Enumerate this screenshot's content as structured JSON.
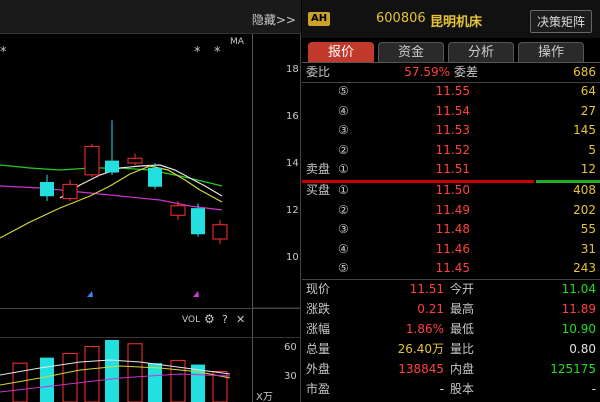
{
  "left_panel": {
    "hide_label": "隐藏>>",
    "ma_label": "MA",
    "stars": [
      "*",
      "*",
      "*"
    ],
    "y_ticks": [
      "18",
      "16",
      "14",
      "12",
      "10"
    ],
    "vol_label": "VOL",
    "vol_ticks": [
      "60",
      "30"
    ],
    "vol_unit": "X万"
  },
  "chart_data": {
    "type": "candlestick",
    "ylim": [
      9,
      19
    ],
    "y_ticks": [
      18,
      16,
      14,
      12,
      10
    ],
    "candles": [
      {
        "o": 13.0,
        "c": 14.1,
        "h": 15.9,
        "l": 12.9,
        "dir": "up"
      },
      {
        "o": 12.4,
        "c": 13.6,
        "h": 13.8,
        "l": 12.4,
        "dir": "up"
      },
      {
        "o": 13.7,
        "c": 13.4,
        "h": 14.2,
        "l": 13.3,
        "dir": "down"
      },
      {
        "o": 13.0,
        "c": 12.4,
        "h": 13.3,
        "l": 12.2,
        "dir": "down"
      },
      {
        "o": 12.0,
        "c": 11.4,
        "h": 12.3,
        "l": 11.2,
        "dir": "down"
      },
      {
        "o": 12.5,
        "c": 11.6,
        "h": 12.6,
        "l": 11.4,
        "dir": "down"
      }
    ],
    "volume_ylim": [
      0,
      75
    ],
    "volume_ticks": [
      60,
      30
    ]
  },
  "header": {
    "badge": "AH",
    "code": "600806",
    "name": "昆明机床",
    "decision_button": "决策矩阵"
  },
  "tabs": [
    {
      "label": "报价",
      "active": true
    },
    {
      "label": "资金",
      "active": false
    },
    {
      "label": "分析",
      "active": false
    },
    {
      "label": "操作",
      "active": false
    }
  ],
  "order_ratio": {
    "label": "委比",
    "value": "57.59%",
    "diff_label": "委差",
    "diff_value": "686"
  },
  "asks": [
    {
      "label": "",
      "level": "⑤",
      "price": "11.55",
      "vol": "64"
    },
    {
      "label": "",
      "level": "④",
      "price": "11.54",
      "vol": "27"
    },
    {
      "label": "",
      "level": "③",
      "price": "11.53",
      "vol": "145"
    },
    {
      "label": "",
      "level": "②",
      "price": "11.52",
      "vol": "5"
    },
    {
      "label": "卖盘",
      "level": "①",
      "price": "11.51",
      "vol": "12"
    }
  ],
  "bids": [
    {
      "label": "买盘",
      "level": "①",
      "price": "11.50",
      "vol": "408"
    },
    {
      "label": "",
      "level": "②",
      "price": "11.49",
      "vol": "202"
    },
    {
      "label": "",
      "level": "③",
      "price": "11.48",
      "vol": "55"
    },
    {
      "label": "",
      "level": "④",
      "price": "11.46",
      "vol": "31"
    },
    {
      "label": "",
      "level": "⑤",
      "price": "11.45",
      "vol": "243"
    }
  ],
  "quote": [
    {
      "l1": "现价",
      "v1": "11.51",
      "c1": "red",
      "l2": "今开",
      "v2": "11.04",
      "c2": "green"
    },
    {
      "l1": "涨跌",
      "v1": "0.21",
      "c1": "red",
      "l2": "最高",
      "v2": "11.89",
      "c2": "red"
    },
    {
      "l1": "涨幅",
      "v1": "1.86%",
      "c1": "red",
      "l2": "最低",
      "v2": "10.90",
      "c2": "green"
    },
    {
      "l1": "总量",
      "v1": "26.40万",
      "c1": "yellow",
      "l2": "量比",
      "v2": "0.80",
      "c2": "white"
    },
    {
      "l1": "外盘",
      "v1": "138845",
      "c1": "red",
      "l2": "内盘",
      "v2": "125175",
      "c2": "green"
    },
    {
      "l1": "市盈",
      "v1": "-",
      "c1": "white",
      "l2": "股本",
      "v2": "-",
      "c2": "white"
    }
  ],
  "colors": {
    "up": "#ff3030",
    "down": "#22e0e0",
    "accent": "#c0392b",
    "ask_bid_bar_red": "#cc0000",
    "ask_bid_bar_green": "#22aa22"
  }
}
